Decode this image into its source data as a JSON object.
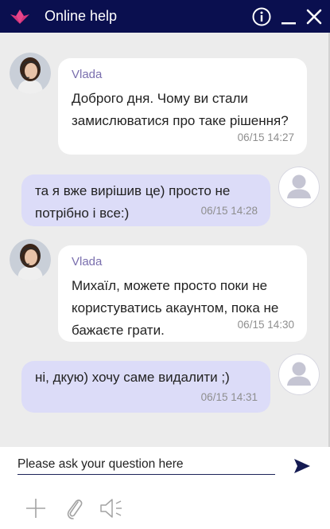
{
  "header": {
    "title": "Online help",
    "icons": [
      "logo-icon",
      "info-icon",
      "minimize-icon",
      "close-icon"
    ],
    "background": "#0a0f4f"
  },
  "messages": [
    {
      "from": "agent",
      "sender": "Vlada",
      "text": "Доброго дня. Чому ви стали замислюватися про таке рішення?",
      "time": "06/15 14:27"
    },
    {
      "from": "user",
      "text": "та я вже вирішив це) просто не потрібно і все:)",
      "time": "06/15 14:28"
    },
    {
      "from": "agent",
      "sender": "Vlada",
      "text": "Михаїл, можете просто поки не користуватись акаунтом, пока не бажаєте грати.",
      "time": "06/15 14:30"
    },
    {
      "from": "user",
      "text": "ні, дкую) хочу саме видалити ;)",
      "time": "06/15 14:31"
    }
  ],
  "composer": {
    "placeholder": "Please ask your question here",
    "value": "",
    "icons": [
      "send-icon",
      "add-icon",
      "attach-icon",
      "sound-icon"
    ]
  },
  "colors": {
    "agent_bubble": "#ffffff",
    "user_bubble": "#dcdcf8",
    "sender_name": "#7a6fae",
    "chat_background": "#ececec"
  }
}
